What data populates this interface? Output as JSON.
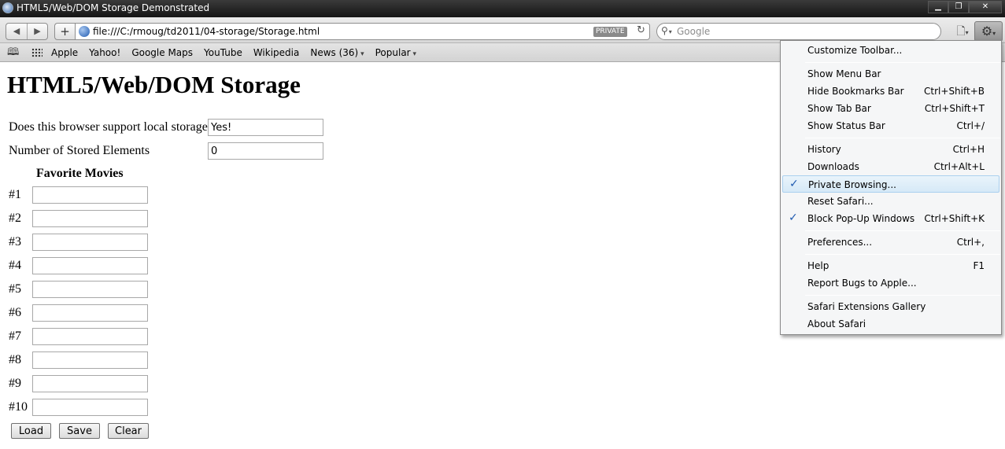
{
  "window": {
    "title": "HTML5/Web/DOM Storage Demonstrated",
    "controls": [
      "▁",
      "❐",
      "✕"
    ]
  },
  "toolbar": {
    "back_glyph": "◀",
    "forward_glyph": "▶",
    "add_glyph": "+",
    "url": "file:///C:/rmoug/td2011/04-storage/Storage.html",
    "private_badge": "PRIVATE",
    "search_placeholder": "Google",
    "icons": [
      "back-icon",
      "forward-icon",
      "plus-icon",
      "globe-icon",
      "reload-icon",
      "search-icon",
      "page-icon",
      "gear-icon"
    ]
  },
  "bookmarks": {
    "items": [
      "Apple",
      "Yahoo!",
      "Google Maps",
      "YouTube",
      "Wikipedia",
      "News (36)",
      "Popular"
    ]
  },
  "page": {
    "heading": "HTML5/Web/DOM Storage",
    "support_label": "Does this browser support local storage?",
    "support_value": "Yes!",
    "count_label": "Number of Stored Elements",
    "count_value": "0",
    "movies_heading": "Favorite Movies",
    "movie_labels": [
      "#1",
      "#2",
      "#3",
      "#4",
      "#5",
      "#6",
      "#7",
      "#8",
      "#9",
      "#10"
    ],
    "buttons": {
      "load": "Load",
      "save": "Save",
      "clear": "Clear"
    }
  },
  "menu": {
    "checkmark": "✓",
    "items": [
      {
        "label": "Customize Toolbar...",
        "shortcut": ""
      },
      {
        "label": "Show Menu Bar",
        "shortcut": ""
      },
      {
        "label": "Hide Bookmarks Bar",
        "shortcut": "Ctrl+Shift+B"
      },
      {
        "label": "Show Tab Bar",
        "shortcut": "Ctrl+Shift+T"
      },
      {
        "label": "Show Status Bar",
        "shortcut": "Ctrl+/"
      },
      {
        "label": "History",
        "shortcut": "Ctrl+H"
      },
      {
        "label": "Downloads",
        "shortcut": "Ctrl+Alt+L"
      },
      {
        "label": "Private Browsing...",
        "shortcut": "",
        "checked": true,
        "highlighted": true
      },
      {
        "label": "Reset Safari...",
        "shortcut": ""
      },
      {
        "label": "Block Pop-Up Windows",
        "shortcut": "Ctrl+Shift+K",
        "checked": true
      },
      {
        "label": "Preferences...",
        "shortcut": "Ctrl+,"
      },
      {
        "label": "Help",
        "shortcut": "F1"
      },
      {
        "label": "Report Bugs to Apple...",
        "shortcut": ""
      },
      {
        "label": "Safari Extensions Gallery",
        "shortcut": ""
      },
      {
        "label": "About Safari",
        "shortcut": ""
      }
    ]
  },
  "colors": {
    "titlebar": "#1e1e1e",
    "menu_highlight": "#d6e9f7",
    "check": "#1f5ab0"
  }
}
